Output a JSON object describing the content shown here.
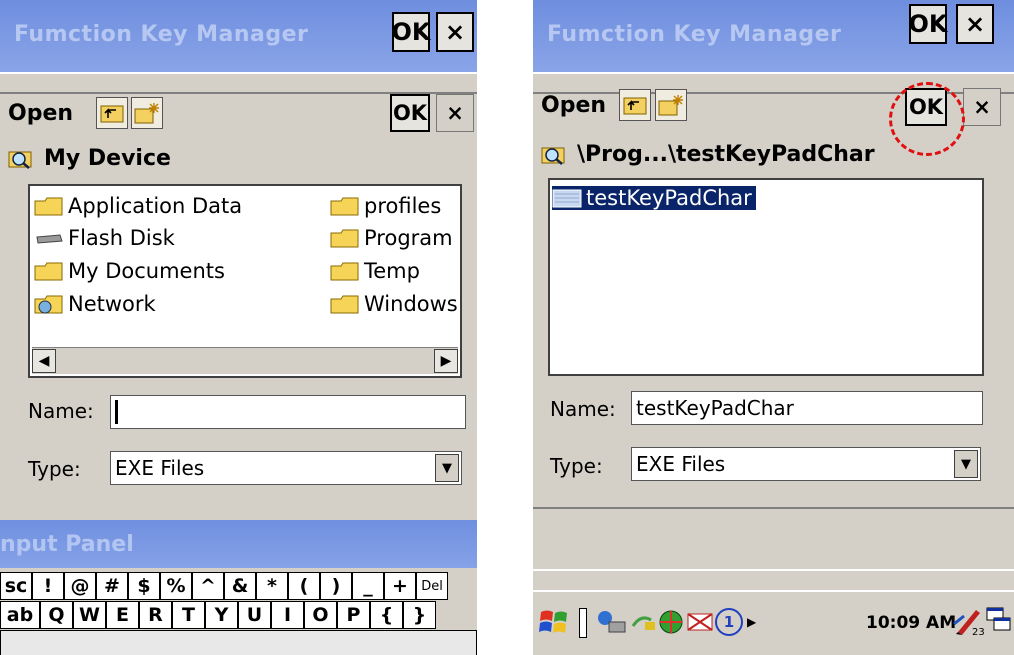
{
  "left": {
    "window_title": "Fumction Key Manager",
    "ok_label": "OK",
    "close_label": "×",
    "dialog": {
      "title": "Open",
      "ok_label": "OK",
      "close_label": "×",
      "location": "My Device",
      "items": [
        {
          "label": "Application Data",
          "icon": "folder-icon"
        },
        {
          "label": "Flash Disk",
          "icon": "drive-icon"
        },
        {
          "label": "My Documents",
          "icon": "folder-icon"
        },
        {
          "label": "Network",
          "icon": "network-icon"
        },
        {
          "label": "profiles",
          "icon": "folder-icon"
        },
        {
          "label": "Program",
          "icon": "folder-icon"
        },
        {
          "label": "Temp",
          "icon": "folder-icon"
        },
        {
          "label": "Windows",
          "icon": "folder-icon"
        }
      ],
      "name_label": "Name:",
      "name_value": "",
      "type_label": "Type:",
      "type_value": "EXE Files"
    },
    "input_panel_title": "nput Panel",
    "keyboard": {
      "row1": [
        "sc",
        "!",
        "@",
        "#",
        "$",
        "%",
        "^",
        "&",
        "*",
        "(",
        ")",
        "_",
        "+",
        "Del"
      ],
      "row2": [
        "ab",
        "Q",
        "W",
        "E",
        "R",
        "T",
        "Y",
        "U",
        "I",
        "O",
        "P",
        "{",
        "}"
      ]
    }
  },
  "right": {
    "window_title": "Fumction Key Manager",
    "ok_label": "OK",
    "close_label": "×",
    "dialog": {
      "title": "Open",
      "ok_label": "OK",
      "close_label": "×",
      "location": "\\Prog...\\testKeyPadChar",
      "items": [
        {
          "label": "testKeyPadChar",
          "icon": "file-icon",
          "selected": true
        }
      ],
      "name_label": "Name:",
      "name_value": "testKeyPadChar",
      "type_label": "Type:",
      "type_value": "EXE Files"
    },
    "taskbar": {
      "clock": "10:09 AM",
      "input_number": "1"
    }
  },
  "colors": {
    "highlight": "#e01010",
    "selection": "#0a246a",
    "title_bar": "#7b98e3"
  }
}
